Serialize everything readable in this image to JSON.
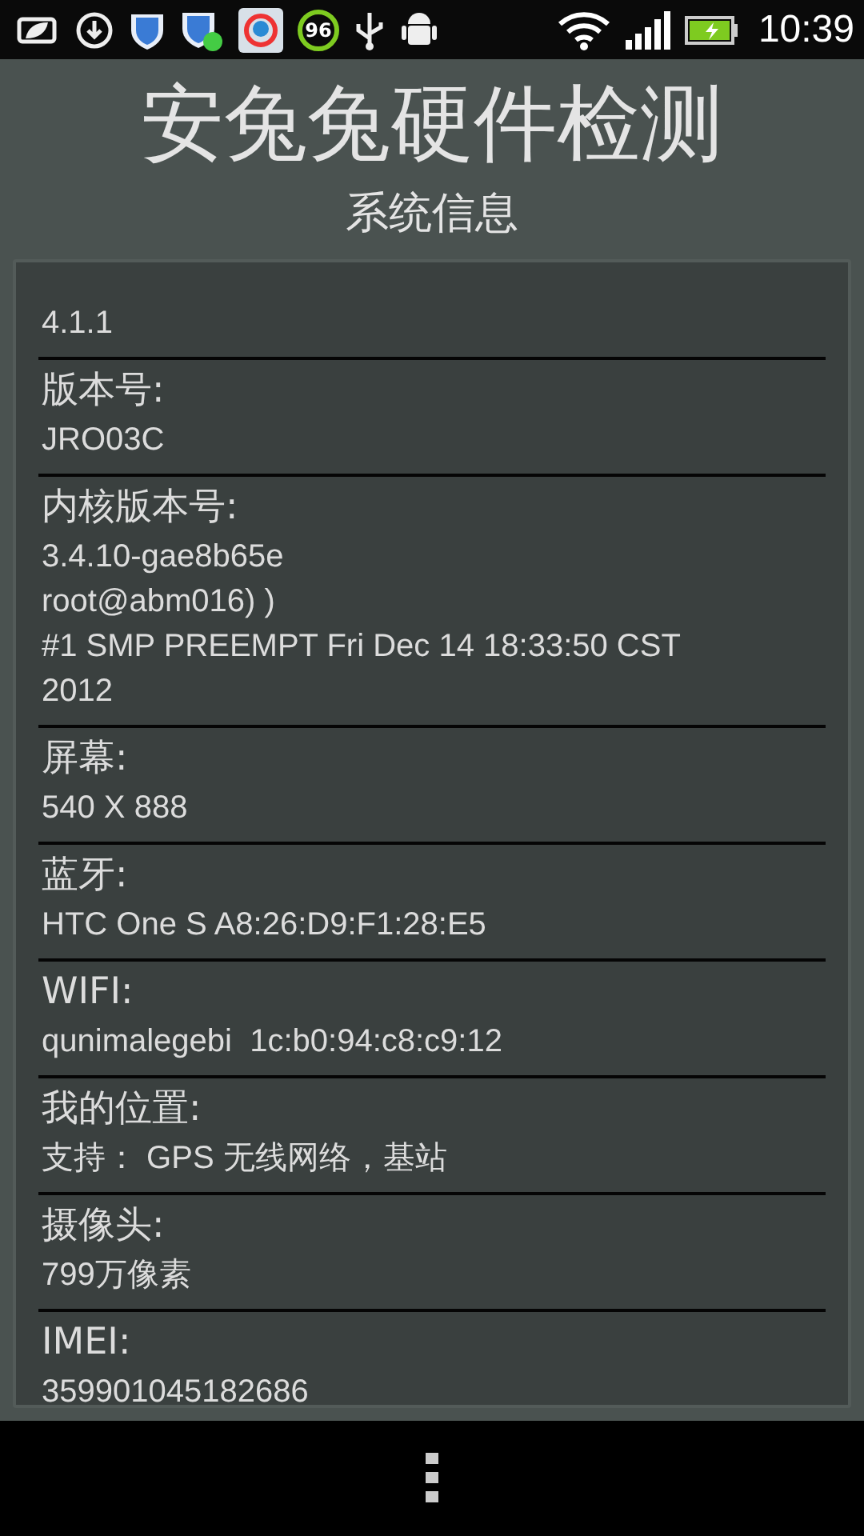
{
  "status_bar": {
    "time": "10:39",
    "notification_badge": "96"
  },
  "title": "安兔兔硬件检测",
  "subtitle": "系统信息",
  "entries": [
    {
      "values": [
        "4.1.1"
      ]
    },
    {
      "label": "版本号:",
      "values": [
        "JRO03C"
      ]
    },
    {
      "label": "内核版本号:",
      "values": [
        "3.4.10-gae8b65e",
        "root@abm016) )",
        "#1 SMP PREEMPT Fri Dec 14 18:33:50 CST",
        "2012"
      ]
    },
    {
      "label": "屏幕:",
      "values": [
        "540 X 888"
      ]
    },
    {
      "label": "蓝牙:",
      "values": [
        "HTC One S A8:26:D9:F1:28:E5"
      ]
    },
    {
      "label": "WIFI:",
      "values": [
        "qunimalegebi  1c:b0:94:c8:c9:12"
      ]
    },
    {
      "label": "我的位置:",
      "values": [
        "支持： GPS 无线网络，基站"
      ]
    },
    {
      "label": "摄像头:",
      "values": [
        "799万像素"
      ]
    },
    {
      "label": "IMEI:",
      "values": [
        "359901045182686"
      ]
    }
  ]
}
